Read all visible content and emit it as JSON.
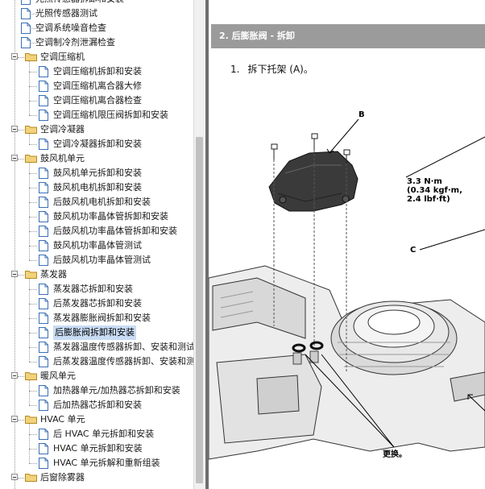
{
  "tree": {
    "items": [
      {
        "label": "光照传感器拆卸和安装",
        "type": "doc",
        "level": 2
      },
      {
        "label": "光照传感器测试",
        "type": "doc",
        "level": 2
      },
      {
        "label": "空调系统噪音检查",
        "type": "doc",
        "level": 2
      },
      {
        "label": "空调制冷剂泄漏检查",
        "type": "doc",
        "level": 2
      },
      {
        "label": "空调压缩机",
        "type": "folder",
        "level": 1
      },
      {
        "label": "空调压缩机拆卸和安装",
        "type": "doc",
        "level": 2
      },
      {
        "label": "空调压缩机离合器大修",
        "type": "doc",
        "level": 2
      },
      {
        "label": "空调压缩机离合器检查",
        "type": "doc",
        "level": 2
      },
      {
        "label": "空调压缩机限压阀拆卸和安装",
        "type": "doc",
        "level": 2
      },
      {
        "label": "空调冷凝器",
        "type": "folder",
        "level": 1
      },
      {
        "label": "空调冷凝器拆卸和安装",
        "type": "doc",
        "level": 2
      },
      {
        "label": "鼓风机单元",
        "type": "folder",
        "level": 1
      },
      {
        "label": "鼓风机单元拆卸和安装",
        "type": "doc",
        "level": 2
      },
      {
        "label": "鼓风机电机拆卸和安装",
        "type": "doc",
        "level": 2
      },
      {
        "label": "后鼓风机电机拆卸和安装",
        "type": "doc",
        "level": 2
      },
      {
        "label": "鼓风机功率晶体管拆卸和安装",
        "type": "doc",
        "level": 2
      },
      {
        "label": "后鼓风机功率晶体管拆卸和安装",
        "type": "doc",
        "level": 2
      },
      {
        "label": "鼓风机功率晶体管测试",
        "type": "doc",
        "level": 2
      },
      {
        "label": "后鼓风机功率晶体管测试",
        "type": "doc",
        "level": 2
      },
      {
        "label": "蒸发器",
        "type": "folder",
        "level": 1
      },
      {
        "label": "蒸发器芯拆卸和安装",
        "type": "doc",
        "level": 2
      },
      {
        "label": "后蒸发器芯拆卸和安装",
        "type": "doc",
        "level": 2
      },
      {
        "label": "蒸发器膨胀阀拆卸和安装",
        "type": "doc",
        "level": 2
      },
      {
        "label": "后膨胀阀拆卸和安装",
        "type": "doc",
        "level": 2,
        "selected": true
      },
      {
        "label": "蒸发器温度传感器拆卸、安装和测试",
        "type": "doc",
        "level": 2
      },
      {
        "label": "后蒸发器温度传感器拆卸、安装和测试",
        "type": "doc",
        "level": 2
      },
      {
        "label": "暖风单元",
        "type": "folder",
        "level": 1
      },
      {
        "label": "加热器单元/加热器芯拆卸和安装",
        "type": "doc",
        "level": 2
      },
      {
        "label": "后加热器芯拆卸和安装",
        "type": "doc",
        "level": 2
      },
      {
        "label": "HVAC 单元",
        "type": "folder",
        "level": 1
      },
      {
        "label": "后 HVAC 单元拆卸和安装",
        "type": "doc",
        "level": 2
      },
      {
        "label": "HVAC 单元拆卸和安装",
        "type": "doc",
        "level": 2
      },
      {
        "label": "HVAC 单元拆解和重新组装",
        "type": "doc",
        "level": 2
      },
      {
        "label": "后窗除雾器",
        "type": "folder",
        "level": 1
      }
    ]
  },
  "content": {
    "section_title": "2. 后膨胀阀 - 拆卸",
    "step_number": "1.",
    "step_text": "拆下托架 (A)。",
    "callouts": {
      "b": "B",
      "c": "C",
      "torque": "3.3 N·m\n(0.34 kgf·m,\n2.4 lbf·ft)",
      "replace": "更换。"
    }
  },
  "colors": {
    "selection": "#c9dcf5",
    "section_header": "#9b9b9b",
    "divider": "#6e6e6e",
    "folder": "#f2d27a"
  }
}
